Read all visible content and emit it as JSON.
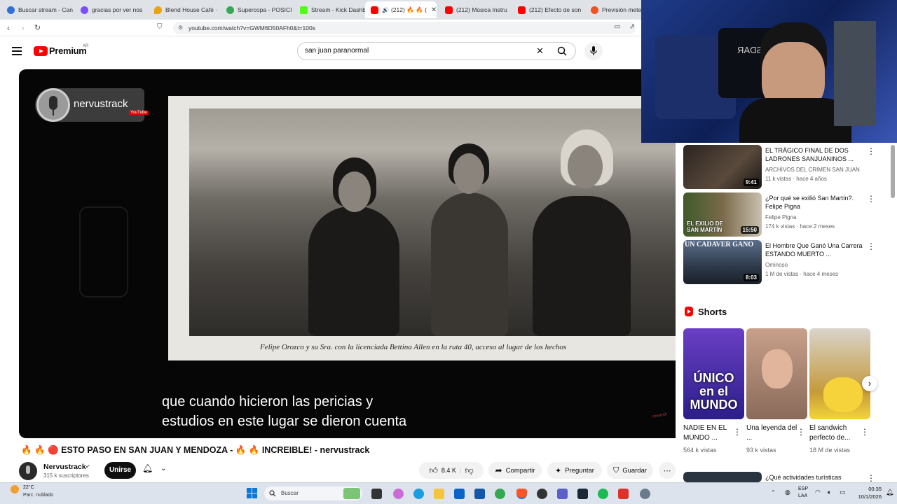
{
  "browser": {
    "tabs": [
      {
        "label": "Buscar stream - Can",
        "color": "#2f6fd6"
      },
      {
        "label": "gracias por ver nos",
        "color": "#7c4dff"
      },
      {
        "label": "Blend House Café ·",
        "color": "#e8a317"
      },
      {
        "label": "Supercopa - POSICI",
        "color": "#34a853"
      },
      {
        "label": "Stream - Kick Dashb",
        "color": "#53fc18"
      },
      {
        "label": "(212) 🔥 🔥 (",
        "color": "#ff0000"
      },
      {
        "label": "(212) Música Instru",
        "color": "#ff0000"
      },
      {
        "label": "(212) Efecto de son",
        "color": "#ff0000"
      },
      {
        "label": "Previsión meteor",
        "color": "#f4511e"
      }
    ],
    "url": "youtube.com/watch?v=GWM6D50AFh0&t=100s"
  },
  "youtube": {
    "logo_text": "Premium",
    "logo_region": "AR",
    "search_value": "san juan paranormal"
  },
  "video": {
    "channel_watermark": "nervustrack",
    "channel_watermark_sub": "YouTube",
    "photo_caption": "Felipe Orozco y su Sra. con la licenciada Bettina Allen en la ruta 40, acceso al lugar de los hechos",
    "subtitle": "que cuando hicieron las pericias y\nestudios en este lugar se dieron cuenta",
    "corner_mark": "nrvstrck",
    "title": "🔥 🔥 🔴 ESTO PASO EN SAN JUAN Y MENDOZA - 🔥 🔥 INCREIBLE! - nervustrack"
  },
  "channel": {
    "name": "Nervustrack",
    "subs": "315 k suscriptores",
    "join_label": "Unirse"
  },
  "actions": {
    "likes": "8.4 K",
    "share": "Compartir",
    "ask": "Preguntar",
    "save": "Guardar"
  },
  "recommendations": [
    {
      "title": "EL TRÁGICO FINAL DE DOS LADRONES SANJUANINOS ...",
      "channel": "ARCHIVOS DEL CRIMEN SAN JUAN",
      "meta": "11 k vistas · hace 4 años",
      "duration": "9:41",
      "thumb_text": ""
    },
    {
      "title": "¿Por qué se exilió San Martín?. Felipe Pigna",
      "channel": "Felipe Pigna",
      "meta": "174 k vistas · hace 2 meses",
      "duration": "15:50",
      "thumb_text": "EL EXILIO DE SAN MARTÍN"
    },
    {
      "title": "El Hombre Que Ganó Una Carrera ESTANDO MUERTO ...",
      "channel": "Ominoso",
      "meta": "1 M de vistas · hace 4 meses",
      "duration": "8:03",
      "thumb_text": "UN CADAVER GANO"
    },
    {
      "title": "¿Qué actividades turísticas",
      "channel": "",
      "meta": "",
      "duration": "",
      "thumb_text": ""
    }
  ],
  "shorts": {
    "heading": "Shorts",
    "items": [
      {
        "title": "NADIE EN EL MUNDO ...",
        "views": "564 k vistas",
        "thumb_text": "ÚNICO en el MUNDO"
      },
      {
        "title": "Una leyenda del ...",
        "views": "93 k vistas",
        "thumb_text": ""
      },
      {
        "title": "El sandwich perfecto de...",
        "views": "18 M de vistas",
        "thumb_text": ""
      }
    ]
  },
  "taskbar": {
    "weather_temp": "22°C",
    "weather_desc": "Parc. nublado",
    "search_label": "Buscar",
    "lang": "ESP",
    "lang2": "LAA",
    "time": "00:35",
    "date": "10/1/2026"
  }
}
